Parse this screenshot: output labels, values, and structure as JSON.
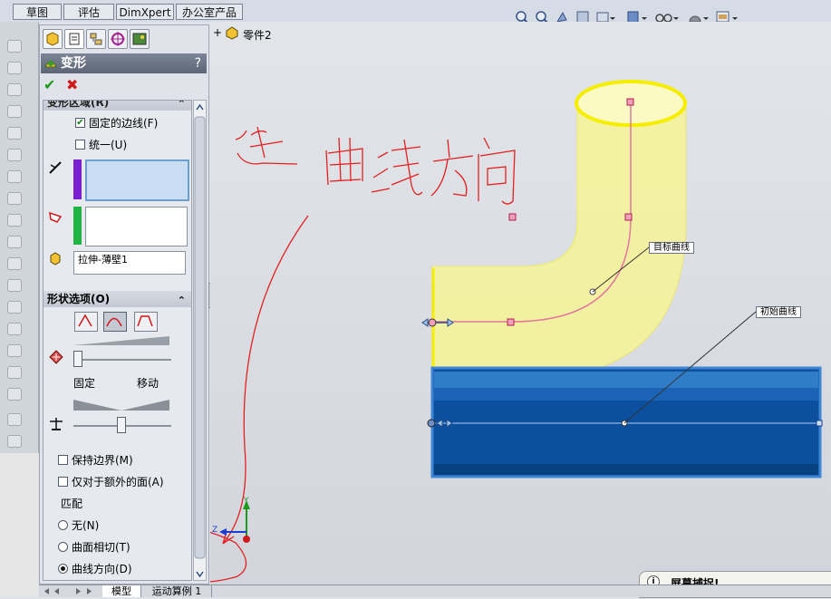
{
  "command_tabs": [
    "草图",
    "评估",
    "DimXpert",
    "办公室产品"
  ],
  "feature_tree": {
    "root_label": "零件2",
    "expand_glyph": "+"
  },
  "panel": {
    "title": "变形",
    "help": "?",
    "ok_glyph": "✔",
    "cancel_glyph": "✖",
    "region_section_title": "变形区域(R)",
    "fixed_edges_label": "固定的边线(F)",
    "fixed_edges_checked": true,
    "uniform_label": "统一(U)",
    "uniform_checked": false,
    "body_field_value": "拉伸-薄壁1",
    "shape_section_title": "形状选项(O)",
    "slider_fixed_label": "固定",
    "slider_move_label": "移动",
    "keep_boundary_label": "保持边界(M)",
    "only_extra_faces_label": "仅对于额外的面(A)",
    "match_label": "匹配",
    "match_options": [
      "无(N)",
      "曲面相切(T)",
      "曲线方向(D)"
    ],
    "match_selected_index": 2,
    "collapse_glyph": "⌃"
  },
  "bottom_tabs": [
    "模型",
    "运动算例 1"
  ],
  "viewport": {
    "callout_target": "目标曲线",
    "callout_initial": "初始曲线",
    "triad": {
      "y": "Y",
      "z": "Z"
    },
    "annotation": "选曲线方向",
    "popup_title": "屏幕捕捉!"
  },
  "colors": {
    "accent_red": "#e32020",
    "yellow_body": "#f5f38a",
    "blue_body": "#0d4fa0",
    "panel_header": "#636c7c"
  }
}
